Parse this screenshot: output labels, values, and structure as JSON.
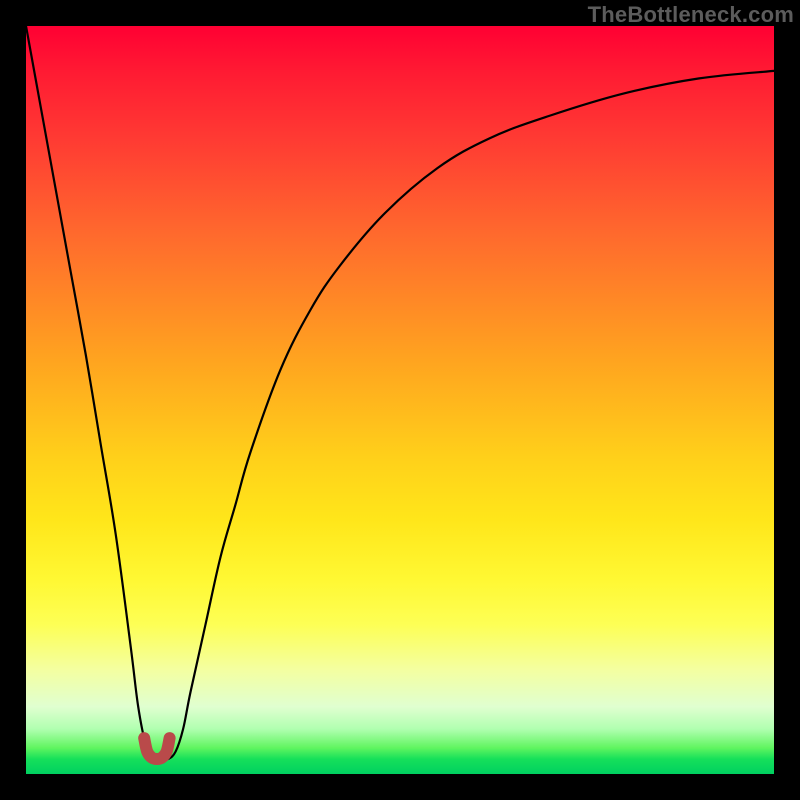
{
  "attribution": "TheBottleneck.com",
  "chart_data": {
    "type": "line",
    "title": "",
    "xlabel": "",
    "ylabel": "",
    "xlim": [
      0,
      100
    ],
    "ylim": [
      0,
      100
    ],
    "grid": false,
    "series": [
      {
        "name": "bottleneck-curve",
        "x": [
          0,
          2,
          4,
          6,
          8,
          10,
          12,
          14,
          15,
          16,
          17,
          18,
          19,
          20,
          21,
          22,
          24,
          26,
          28,
          30,
          34,
          38,
          42,
          48,
          55,
          62,
          70,
          80,
          90,
          100
        ],
        "values": [
          100,
          89,
          78,
          67,
          56,
          44,
          32,
          17,
          9,
          4,
          2,
          2,
          2,
          3,
          6,
          11,
          20,
          29,
          36,
          43,
          54,
          62,
          68,
          75,
          81,
          85,
          88,
          91,
          93,
          94
        ]
      },
      {
        "name": "minimum-marker",
        "x": [
          15.8,
          16.2,
          16.8,
          17.5,
          18.2,
          18.8,
          19.2
        ],
        "values": [
          4.8,
          3.0,
          2.2,
          2.0,
          2.2,
          3.0,
          4.8
        ]
      }
    ],
    "colors": {
      "curve": "#000000",
      "marker": "#b94a4a",
      "gradient_top": "#ff0033",
      "gradient_bottom": "#00d060"
    }
  }
}
